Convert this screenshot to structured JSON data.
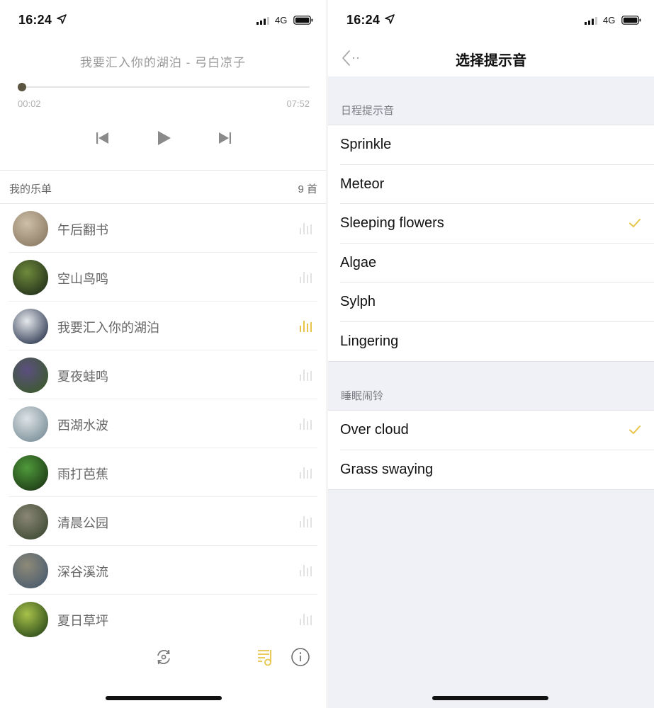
{
  "status_bar": {
    "time": "16:24",
    "network": "4G"
  },
  "player": {
    "now_playing": "我要汇入你的湖泊 - 弓白凉子",
    "current_time": "00:02",
    "total_time": "07:52",
    "progress": 0.004,
    "controls": {
      "prev": "previous-track",
      "play": "play",
      "next": "next-track"
    },
    "playlist_label": "我的乐单",
    "playlist_count": "9 首",
    "accent_color": "#E8C54A",
    "tracks": [
      {
        "name": "午后翻书",
        "playing": false,
        "thumb_colors": [
          "#cdbfa8",
          "#8b7a64"
        ]
      },
      {
        "name": "空山鸟鸣",
        "playing": false,
        "thumb_colors": [
          "#6f8a3c",
          "#22301a"
        ]
      },
      {
        "name": "我要汇入你的湖泊",
        "playing": true,
        "thumb_colors": [
          "#e6e9ec",
          "#2e3a52"
        ]
      },
      {
        "name": "夏夜蛙鸣",
        "playing": false,
        "thumb_colors": [
          "#5b4f80",
          "#3c5a2c"
        ]
      },
      {
        "name": "西湖水波",
        "playing": false,
        "thumb_colors": [
          "#dde3e6",
          "#7a8e98"
        ]
      },
      {
        "name": "雨打芭蕉",
        "playing": false,
        "thumb_colors": [
          "#4f9a3b",
          "#1d3a16"
        ]
      },
      {
        "name": "清晨公园",
        "playing": false,
        "thumb_colors": [
          "#8a8676",
          "#3e4a34"
        ]
      },
      {
        "name": "深谷溪流",
        "playing": false,
        "thumb_colors": [
          "#8e8a78",
          "#4a5c6e"
        ]
      },
      {
        "name": "夏日草坪",
        "playing": false,
        "thumb_colors": [
          "#a8c24a",
          "#2c4a1a"
        ]
      }
    ],
    "bottom_icons": [
      "loop-icon",
      "playlist-icon",
      "info-icon"
    ]
  },
  "tone_select": {
    "title": "选择提示音",
    "check_color": "#E8C54A",
    "sections": [
      {
        "header": "日程提示音",
        "items": [
          {
            "label": "Sprinkle",
            "selected": false
          },
          {
            "label": "Meteor",
            "selected": false
          },
          {
            "label": "Sleeping flowers",
            "selected": true
          },
          {
            "label": "Algae",
            "selected": false
          },
          {
            "label": "Sylph",
            "selected": false
          },
          {
            "label": "Lingering",
            "selected": false
          }
        ]
      },
      {
        "header": "睡眠闹铃",
        "items": [
          {
            "label": "Over cloud",
            "selected": true
          },
          {
            "label": "Grass swaying",
            "selected": false
          }
        ]
      }
    ]
  }
}
